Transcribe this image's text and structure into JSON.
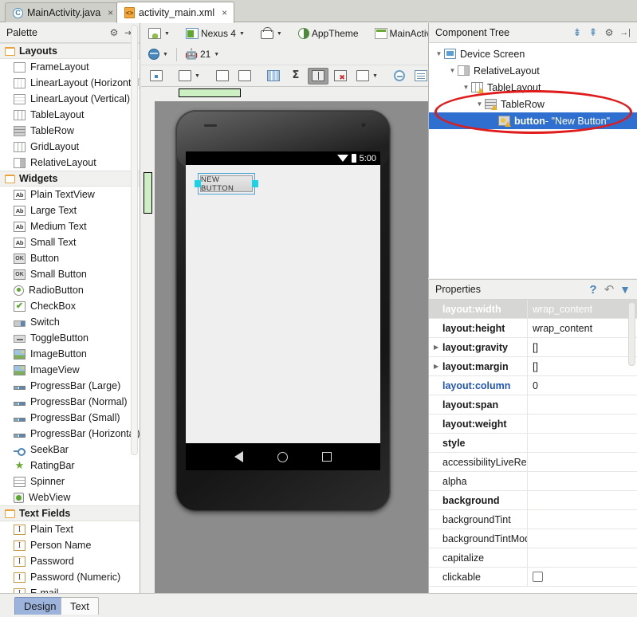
{
  "editor_tabs": [
    {
      "label": "MainActivity.java",
      "icon": "java-class-icon",
      "active": false,
      "close": "×"
    },
    {
      "label": "activity_main.xml",
      "icon": "xml-file-icon",
      "active": true,
      "close": "×"
    }
  ],
  "palette": {
    "title": "Palette",
    "gear_icon": "⚙",
    "collapse_icon": "⇥",
    "groups": [
      {
        "label": "Layouts",
        "items": [
          {
            "label": "FrameLayout",
            "icon": "frame-layout-icon",
            "glyph": ""
          },
          {
            "label": "LinearLayout (Horizontal)",
            "icon": "linear-layout-horizontal-icon",
            "glyph": ""
          },
          {
            "label": "LinearLayout (Vertical)",
            "icon": "linear-layout-vertical-icon",
            "glyph": ""
          },
          {
            "label": "TableLayout",
            "icon": "table-layout-icon",
            "glyph": ""
          },
          {
            "label": "TableRow",
            "icon": "table-row-icon",
            "glyph": ""
          },
          {
            "label": "GridLayout",
            "icon": "grid-layout-icon",
            "glyph": ""
          },
          {
            "label": "RelativeLayout",
            "icon": "relative-layout-icon",
            "glyph": ""
          }
        ]
      },
      {
        "label": "Widgets",
        "items": [
          {
            "label": "Plain TextView",
            "icon": "text-ab-icon",
            "glyph": "Ab"
          },
          {
            "label": "Large Text",
            "icon": "text-ab-icon",
            "glyph": "Ab"
          },
          {
            "label": "Medium Text",
            "icon": "text-ab-icon",
            "glyph": "Ab"
          },
          {
            "label": "Small Text",
            "icon": "text-ab-icon",
            "glyph": "Ab"
          },
          {
            "label": "Button",
            "icon": "button-ok-icon",
            "glyph": "OK"
          },
          {
            "label": "Small Button",
            "icon": "button-ok-icon",
            "glyph": "OK"
          },
          {
            "label": "RadioButton",
            "icon": "radio-button-icon",
            "glyph": ""
          },
          {
            "label": "CheckBox",
            "icon": "checkbox-icon",
            "glyph": "✔"
          },
          {
            "label": "Switch",
            "icon": "switch-icon",
            "glyph": ""
          },
          {
            "label": "ToggleButton",
            "icon": "toggle-button-icon",
            "glyph": ""
          },
          {
            "label": "ImageButton",
            "icon": "image-button-icon",
            "glyph": ""
          },
          {
            "label": "ImageView",
            "icon": "image-view-icon",
            "glyph": ""
          },
          {
            "label": "ProgressBar (Large)",
            "icon": "progressbar-icon",
            "glyph": ""
          },
          {
            "label": "ProgressBar (Normal)",
            "icon": "progressbar-icon",
            "glyph": ""
          },
          {
            "label": "ProgressBar (Small)",
            "icon": "progressbar-icon",
            "glyph": ""
          },
          {
            "label": "ProgressBar (Horizontal)",
            "icon": "progressbar-icon",
            "glyph": ""
          },
          {
            "label": "SeekBar",
            "icon": "seekbar-icon",
            "glyph": ""
          },
          {
            "label": "RatingBar",
            "icon": "rating-bar-icon",
            "glyph": "★"
          },
          {
            "label": "Spinner",
            "icon": "spinner-icon",
            "glyph": ""
          },
          {
            "label": "WebView",
            "icon": "web-view-icon",
            "glyph": ""
          }
        ]
      },
      {
        "label": "Text Fields",
        "items": [
          {
            "label": "Plain Text",
            "icon": "text-field-icon",
            "glyph": "I"
          },
          {
            "label": "Person Name",
            "icon": "text-field-icon",
            "glyph": "I"
          },
          {
            "label": "Password",
            "icon": "text-field-icon",
            "glyph": "I"
          },
          {
            "label": "Password (Numeric)",
            "icon": "text-field-icon",
            "glyph": "I"
          },
          {
            "label": "E-mail",
            "icon": "text-field-icon",
            "glyph": "I"
          }
        ]
      }
    ]
  },
  "toolbar": {
    "row1": [
      {
        "label": "",
        "icon": "layout-variant-icon",
        "dropdown": true
      },
      {
        "label": "Nexus 4",
        "icon": "device-icon",
        "dropdown": true
      },
      {
        "label": "",
        "icon": "orientation-icon",
        "dropdown": true
      },
      {
        "label": "AppTheme",
        "icon": "theme-icon",
        "dropdown": false
      },
      {
        "label": "MainActivity",
        "icon": "activity-icon",
        "dropdown": true
      }
    ],
    "row2": [
      {
        "label": "",
        "icon": "locale-globe-icon",
        "dropdown": true
      },
      {
        "label": "21",
        "icon": "android-api-icon",
        "dropdown": true
      }
    ],
    "row3": [
      {
        "icon": "include-in-icon",
        "pressed": false,
        "dropdown": false
      },
      {
        "icon": "expand-to-fit-icon",
        "pressed": false,
        "dropdown": true
      },
      {
        "icon": "distribute-horizontal-icon",
        "pressed": false,
        "dropdown": false
      },
      {
        "icon": "distribute-vertical-icon",
        "pressed": false,
        "dropdown": false
      },
      {
        "icon": "show-columns-icon",
        "pressed": false,
        "dropdown": false
      },
      {
        "icon": "sum-icon",
        "pressed": false,
        "dropdown": false
      },
      {
        "icon": "balance-icon",
        "pressed": true,
        "dropdown": false
      },
      {
        "icon": "show-errors-icon",
        "pressed": false,
        "dropdown": false
      },
      {
        "icon": "fit-selection-icon",
        "pressed": false,
        "dropdown": true
      },
      {
        "icon": "zoom-out-icon",
        "pressed": false,
        "dropdown": false
      },
      {
        "icon": "document-icon",
        "pressed": false,
        "dropdown": false
      },
      {
        "icon": "refresh-icon",
        "pressed": false,
        "dropdown": false
      },
      {
        "icon": "settings-gear-icon",
        "pressed": false,
        "dropdown": true
      }
    ]
  },
  "preview": {
    "device_status_time": "5:00",
    "wifi_icon": "wifi-icon",
    "battery_icon": "battery-icon",
    "selected_widget_label": "NEW BUTTON",
    "nav_back_icon": "nav-back-icon",
    "nav_home_icon": "nav-home-icon",
    "nav_recents_icon": "nav-recents-icon",
    "guide_top_name": "horizontal-guide-marker",
    "guide_left_name": "vertical-guide-marker"
  },
  "component_tree": {
    "title": "Component Tree",
    "expand_all_icon": "expand-all-icon",
    "collapse_all_icon": "collapse-all-icon",
    "gear_icon": "⚙",
    "hide_icon": "→|",
    "nodes": [
      {
        "label": "Device Screen",
        "sub": "",
        "indent": 0,
        "arrow": "▼",
        "icon": "device-screen-icon",
        "selected": false,
        "warn": false
      },
      {
        "label": "RelativeLayout",
        "sub": "",
        "indent": 1,
        "arrow": "▼",
        "icon": "relative-layout-icon",
        "selected": false,
        "warn": false
      },
      {
        "label": "TableLayout",
        "sub": "",
        "indent": 2,
        "arrow": "▼",
        "icon": "table-layout-icon",
        "selected": false,
        "warn": true
      },
      {
        "label": "TableRow",
        "sub": "",
        "indent": 3,
        "arrow": "▼",
        "icon": "table-row-icon",
        "selected": false,
        "warn": true
      },
      {
        "label": "button",
        "sub": " - \"New Button\"",
        "indent": 4,
        "arrow": "",
        "icon": "button-widget-icon",
        "selected": true,
        "warn": true
      }
    ],
    "annotation": "red-ellipse-highlight"
  },
  "properties": {
    "title": "Properties",
    "help_icon": "?",
    "reset_icon": "↶",
    "filter_icon": "filter-icon",
    "rows": [
      {
        "name": "layout:width",
        "value": "wrap_content",
        "bold": true,
        "link": false,
        "expand": false,
        "highlight": true,
        "checkbox": false
      },
      {
        "name": "layout:height",
        "value": "wrap_content",
        "bold": true,
        "link": false,
        "expand": false,
        "highlight": false,
        "checkbox": false
      },
      {
        "name": "layout:gravity",
        "value": "[]",
        "bold": true,
        "link": false,
        "expand": true,
        "highlight": false,
        "checkbox": false
      },
      {
        "name": "layout:margin",
        "value": "[]",
        "bold": true,
        "link": false,
        "expand": true,
        "highlight": false,
        "checkbox": false
      },
      {
        "name": "layout:column",
        "value": "0",
        "bold": true,
        "link": true,
        "expand": false,
        "highlight": false,
        "checkbox": false
      },
      {
        "name": "layout:span",
        "value": "",
        "bold": true,
        "link": false,
        "expand": false,
        "highlight": false,
        "checkbox": false
      },
      {
        "name": "layout:weight",
        "value": "",
        "bold": true,
        "link": false,
        "expand": false,
        "highlight": false,
        "checkbox": false
      },
      {
        "name": "style",
        "value": "",
        "bold": true,
        "link": false,
        "expand": false,
        "highlight": false,
        "checkbox": false
      },
      {
        "name": "accessibilityLiveRegion",
        "value": "",
        "bold": false,
        "link": false,
        "expand": false,
        "highlight": false,
        "checkbox": false
      },
      {
        "name": "alpha",
        "value": "",
        "bold": false,
        "link": false,
        "expand": false,
        "highlight": false,
        "checkbox": false
      },
      {
        "name": "background",
        "value": "",
        "bold": true,
        "link": false,
        "expand": false,
        "highlight": false,
        "checkbox": false
      },
      {
        "name": "backgroundTint",
        "value": "",
        "bold": false,
        "link": false,
        "expand": false,
        "highlight": false,
        "checkbox": false
      },
      {
        "name": "backgroundTintMode",
        "value": "",
        "bold": false,
        "link": false,
        "expand": false,
        "highlight": false,
        "checkbox": false
      },
      {
        "name": "capitalize",
        "value": "",
        "bold": false,
        "link": false,
        "expand": false,
        "highlight": false,
        "checkbox": false
      },
      {
        "name": "clickable",
        "value": "",
        "bold": false,
        "link": false,
        "expand": false,
        "highlight": false,
        "checkbox": true
      }
    ]
  },
  "bottom_tabs": [
    {
      "label": "Design",
      "selected": true
    },
    {
      "label": "Text",
      "selected": false
    }
  ],
  "colors": {
    "selection_blue": "#2f6fd0",
    "annotation_red": "#e01b1b",
    "guide_green": "#cdf0c2",
    "handle_cyan": "#1ed2e6",
    "tab_active_blue": "#9cb4dc"
  }
}
